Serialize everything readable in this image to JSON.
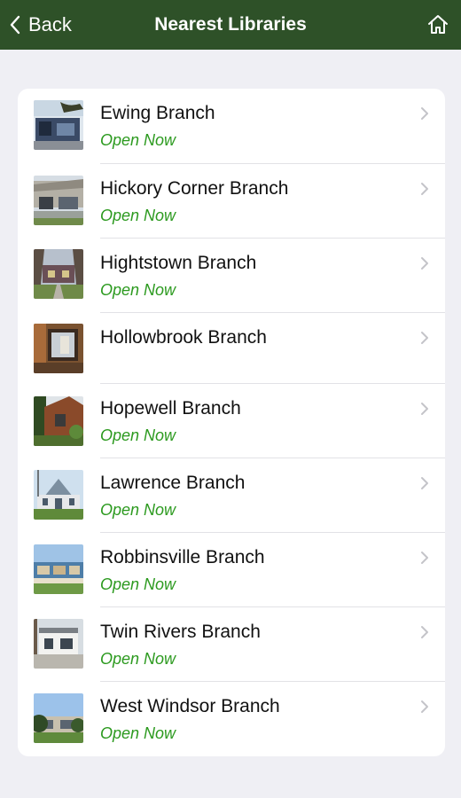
{
  "nav": {
    "back_label": "Back",
    "title": "Nearest Libraries",
    "home_icon": "home-icon"
  },
  "colors": {
    "nav_bg": "#2e5128",
    "status_green": "#2c9a1f",
    "page_bg": "#efeff4"
  },
  "libraries": [
    {
      "name": "Ewing Branch",
      "status": "Open Now"
    },
    {
      "name": "Hickory Corner Branch",
      "status": "Open Now"
    },
    {
      "name": "Hightstown Branch",
      "status": "Open Now"
    },
    {
      "name": "Hollowbrook Branch",
      "status": ""
    },
    {
      "name": "Hopewell Branch",
      "status": "Open Now"
    },
    {
      "name": "Lawrence Branch",
      "status": "Open Now"
    },
    {
      "name": "Robbinsville Branch",
      "status": "Open Now"
    },
    {
      "name": "Twin Rivers Branch",
      "status": "Open Now"
    },
    {
      "name": "West Windsor Branch",
      "status": "Open Now"
    }
  ]
}
